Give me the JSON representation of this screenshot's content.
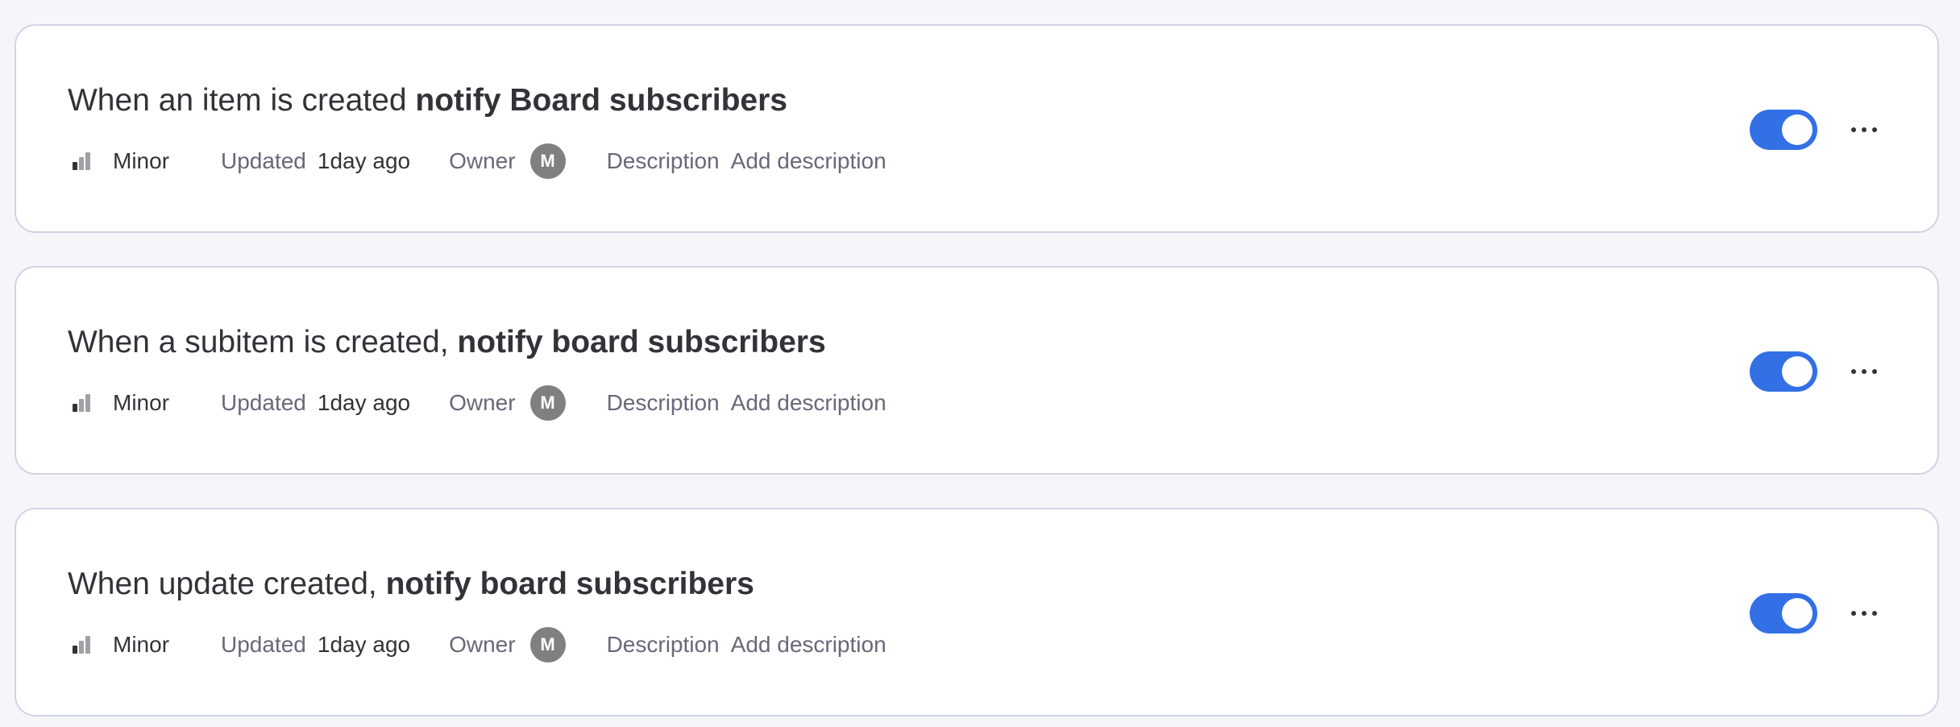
{
  "automations": [
    {
      "title_prefix": "When an item is created ",
      "title_action": "notify Board subscribers",
      "priority_label": "Minor",
      "updated_label": "Updated",
      "updated_value": "1day ago",
      "owner_label": "Owner",
      "owner_initial": "M",
      "description_label": "Description",
      "description_value": "Add description",
      "enabled": true
    },
    {
      "title_prefix": "When a subitem is created, ",
      "title_action": "notify board subscribers",
      "priority_label": "Minor",
      "updated_label": "Updated",
      "updated_value": "1day ago",
      "owner_label": "Owner",
      "owner_initial": "M",
      "description_label": "Description",
      "description_value": "Add description",
      "enabled": true
    },
    {
      "title_prefix": "When update created, ",
      "title_action": "notify board subscribers",
      "priority_label": "Minor",
      "updated_label": "Updated",
      "updated_value": "1day ago",
      "owner_label": "Owner",
      "owner_initial": "M",
      "description_label": "Description",
      "description_value": "Add description",
      "enabled": true
    }
  ],
  "icons": {
    "priority": "signal-bars-icon",
    "more": "more-horizontal-icon"
  },
  "colors": {
    "page_background": "#f5f6fa",
    "card_border": "#d0d4e4",
    "toggle_on": "#3370e6",
    "avatar": "#808080",
    "text_primary": "#323338",
    "text_secondary": "#676879"
  }
}
